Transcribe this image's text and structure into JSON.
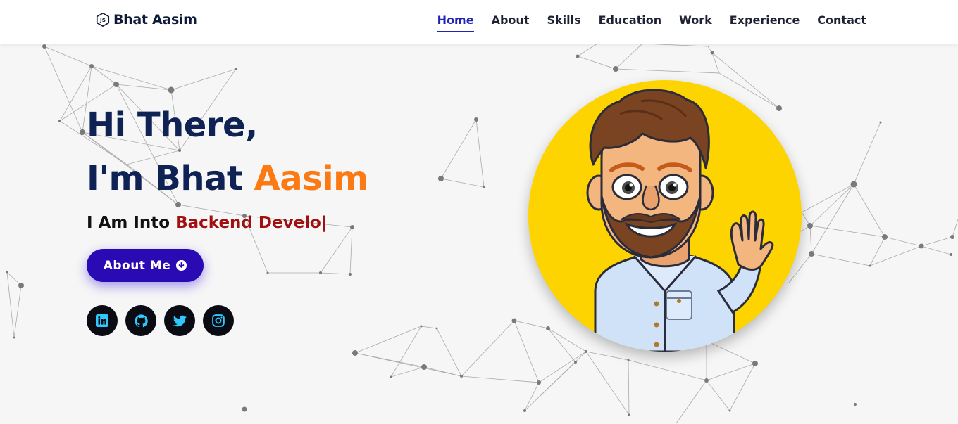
{
  "header": {
    "logo_text": "Bhat Aasim",
    "logo_icon": "nodejs-icon",
    "nav": [
      {
        "label": "Home",
        "active": true
      },
      {
        "label": "About",
        "active": false
      },
      {
        "label": "Skills",
        "active": false
      },
      {
        "label": "Education",
        "active": false
      },
      {
        "label": "Work",
        "active": false
      },
      {
        "label": "Experience",
        "active": false
      },
      {
        "label": "Contact",
        "active": false
      }
    ]
  },
  "hero": {
    "greeting": "Hi There,",
    "intro_prefix": "I'm Bhat ",
    "intro_accent": "Aasim",
    "typed_prefix": "I Am Into ",
    "typed_role": "Backend Develo",
    "typed_cursor": "|",
    "about_button": "About Me",
    "about_button_icon": "arrow-down-circle-icon",
    "socials": [
      {
        "name": "linkedin",
        "icon": "linkedin-icon"
      },
      {
        "name": "github",
        "icon": "github-icon"
      },
      {
        "name": "twitter",
        "icon": "twitter-icon"
      },
      {
        "name": "instagram",
        "icon": "instagram-icon"
      }
    ]
  },
  "colors": {
    "navy": "#0e2253",
    "accent_orange": "#fb7a14",
    "role_red": "#a01010",
    "button_purple": "#2a0ab3",
    "nav_active": "#1f23b8",
    "avatar_bg": "#fdd300",
    "social_icon": "#2ec8ff"
  }
}
